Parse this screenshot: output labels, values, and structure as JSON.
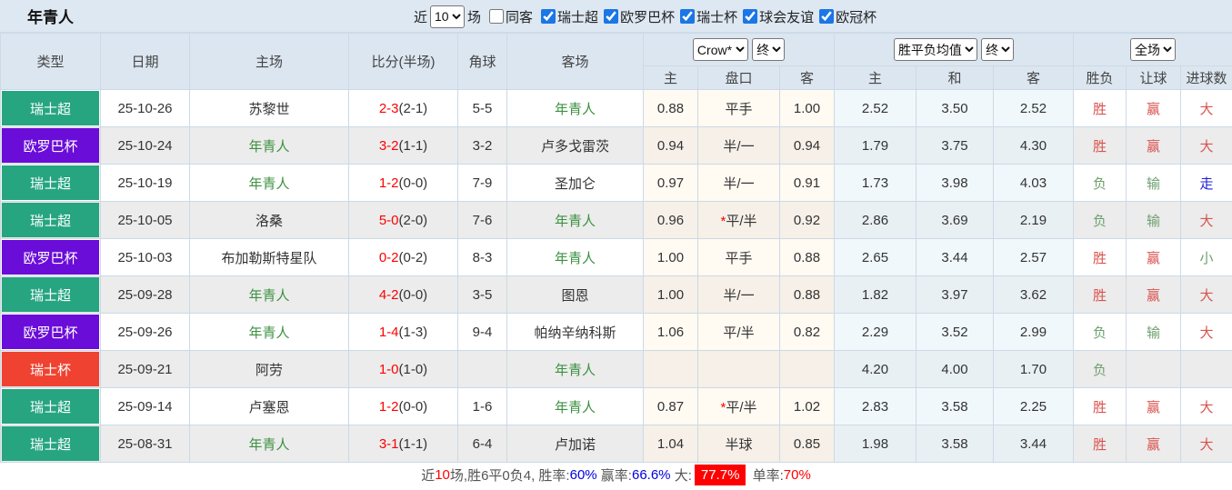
{
  "title": "年青人",
  "colors": {
    "league_super": "#26a580",
    "league_europa": "#6a0dd8",
    "league_cup": "#ef4230",
    "team_green": "#3c9140",
    "win_red": "#d9534f",
    "lose_green": "#70a070",
    "walk_blue": "#2020dd",
    "score_red": "#ff0000",
    "rate_blue": "#0000e0",
    "big_highlight_bg": "#ff0000"
  },
  "topbar": {
    "recent_label": "近",
    "recent_value": "10",
    "matches_label": "场",
    "same_venue": {
      "label": "同客",
      "checked": false
    },
    "leagues": [
      {
        "label": "瑞士超",
        "checked": true
      },
      {
        "label": "欧罗巴杯",
        "checked": true
      },
      {
        "label": "瑞士杯",
        "checked": true
      },
      {
        "label": "球会友谊",
        "checked": true
      },
      {
        "label": "欧冠杯",
        "checked": true
      }
    ]
  },
  "table": {
    "main_headers": [
      "类型",
      "日期",
      "主场",
      "比分(半场)",
      "角球",
      "客场"
    ],
    "dropdowns": {
      "odds_company": "Crow*",
      "asia_time": "终",
      "europe_type": "胜平负均值",
      "europe_time": "终",
      "scope": "全场"
    },
    "sub_headers": [
      "主",
      "盘口",
      "客",
      "主",
      "和",
      "客",
      "胜负",
      "让球",
      "进球数"
    ],
    "rows": [
      {
        "league": "瑞士超",
        "date": "25-10-26",
        "home": "苏黎世",
        "score": "2-3",
        "half": "2-1",
        "corner": "5-5",
        "away": "年青人",
        "asia": [
          "0.88",
          "平手",
          "1.00"
        ],
        "asia_star": false,
        "europe": [
          "2.52",
          "3.50",
          "2.52"
        ],
        "result": "胜",
        "handicap_result": "赢",
        "goal_result": "大"
      },
      {
        "league": "欧罗巴杯",
        "date": "25-10-24",
        "home": "年青人",
        "score": "3-2",
        "half": "1-1",
        "corner": "3-2",
        "away": "卢多戈雷茨",
        "asia": [
          "0.94",
          "半/一",
          "0.94"
        ],
        "asia_star": false,
        "europe": [
          "1.79",
          "3.75",
          "4.30"
        ],
        "result": "胜",
        "handicap_result": "赢",
        "goal_result": "大"
      },
      {
        "league": "瑞士超",
        "date": "25-10-19",
        "home": "年青人",
        "score": "1-2",
        "half": "0-0",
        "corner": "7-9",
        "away": "圣加仑",
        "asia": [
          "0.97",
          "半/一",
          "0.91"
        ],
        "asia_star": false,
        "europe": [
          "1.73",
          "3.98",
          "4.03"
        ],
        "result": "负",
        "handicap_result": "输",
        "goal_result": "走"
      },
      {
        "league": "瑞士超",
        "date": "25-10-05",
        "home": "洛桑",
        "score": "5-0",
        "half": "2-0",
        "corner": "7-6",
        "away": "年青人",
        "asia": [
          "0.96",
          "平/半",
          "0.92"
        ],
        "asia_star": true,
        "europe": [
          "2.86",
          "3.69",
          "2.19"
        ],
        "result": "负",
        "handicap_result": "输",
        "goal_result": "大"
      },
      {
        "league": "欧罗巴杯",
        "date": "25-10-03",
        "home": "布加勒斯特星队",
        "score": "0-2",
        "half": "0-2",
        "corner": "8-3",
        "away": "年青人",
        "asia": [
          "1.00",
          "平手",
          "0.88"
        ],
        "asia_star": false,
        "europe": [
          "2.65",
          "3.44",
          "2.57"
        ],
        "result": "胜",
        "handicap_result": "赢",
        "goal_result": "小"
      },
      {
        "league": "瑞士超",
        "date": "25-09-28",
        "home": "年青人",
        "score": "4-2",
        "half": "0-0",
        "corner": "3-5",
        "away": "图恩",
        "asia": [
          "1.00",
          "半/一",
          "0.88"
        ],
        "asia_star": false,
        "europe": [
          "1.82",
          "3.97",
          "3.62"
        ],
        "result": "胜",
        "handicap_result": "赢",
        "goal_result": "大"
      },
      {
        "league": "欧罗巴杯",
        "date": "25-09-26",
        "home": "年青人",
        "score": "1-4",
        "half": "1-3",
        "corner": "9-4",
        "away": "帕纳辛纳科斯",
        "asia": [
          "1.06",
          "平/半",
          "0.82"
        ],
        "asia_star": false,
        "europe": [
          "2.29",
          "3.52",
          "2.99"
        ],
        "result": "负",
        "handicap_result": "输",
        "goal_result": "大"
      },
      {
        "league": "瑞士杯",
        "date": "25-09-21",
        "home": "阿劳",
        "score": "1-0",
        "half": "1-0",
        "corner": "",
        "away": "年青人",
        "asia": [
          "",
          "",
          ""
        ],
        "asia_star": false,
        "europe": [
          "4.20",
          "4.00",
          "1.70"
        ],
        "result": "负",
        "handicap_result": "",
        "goal_result": ""
      },
      {
        "league": "瑞士超",
        "date": "25-09-14",
        "home": "卢塞恩",
        "score": "1-2",
        "half": "0-0",
        "corner": "1-6",
        "away": "年青人",
        "asia": [
          "0.87",
          "平/半",
          "1.02"
        ],
        "asia_star": true,
        "europe": [
          "2.83",
          "3.58",
          "2.25"
        ],
        "result": "胜",
        "handicap_result": "赢",
        "goal_result": "大"
      },
      {
        "league": "瑞士超",
        "date": "25-08-31",
        "home": "年青人",
        "score": "3-1",
        "half": "1-1",
        "corner": "6-4",
        "away": "卢加诺",
        "asia": [
          "1.04",
          "半球",
          "0.85"
        ],
        "asia_star": false,
        "europe": [
          "1.98",
          "3.58",
          "3.44"
        ],
        "result": "胜",
        "handicap_result": "赢",
        "goal_result": "大"
      }
    ]
  },
  "footer": {
    "prefix": "近",
    "count": "10",
    "summary": "场,胜6平0负4, 胜率:",
    "win_rate": "60%",
    "handicap_label": " 赢率:",
    "handicap_rate": "66.6%",
    "big_label": " 大:",
    "big_rate": "77.7%",
    "single_label": " 单率:",
    "single_rate": "70%"
  }
}
